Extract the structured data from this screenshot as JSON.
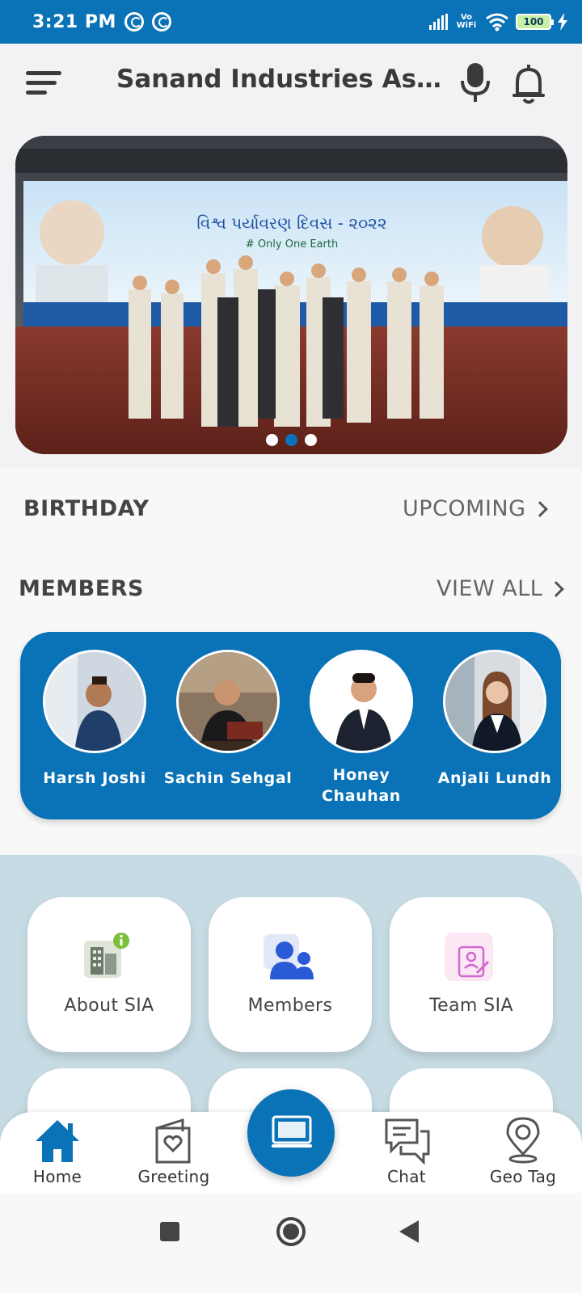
{
  "status_bar": {
    "time": "3:21 PM",
    "network_label": "Vo WiFi",
    "battery": "100"
  },
  "app_bar": {
    "title": "Sanand Industries Associ..."
  },
  "banner": {
    "headline": "વિશ્વ પર્યાવરણ દિવસ - ૨૦૨૨",
    "tagline": "# Only One Earth",
    "active_slide": 2,
    "slide_count": 3
  },
  "birthday": {
    "title": "BIRTHDAY",
    "link": "UPCOMING"
  },
  "members_section": {
    "title": "MEMBERS",
    "link": "VIEW ALL",
    "items": [
      {
        "name": "Harsh  Joshi"
      },
      {
        "name": "Sachin  Sehgal"
      },
      {
        "name": "Honey\nChauhan"
      },
      {
        "name": "Anjali  Lundh"
      }
    ]
  },
  "tiles": [
    {
      "label": "About SIA",
      "icon": "building-info-icon"
    },
    {
      "label": "Members",
      "icon": "users-icon"
    },
    {
      "label": "Team SIA",
      "icon": "id-card-icon"
    }
  ],
  "bottom_nav": {
    "items": [
      {
        "label": "Home",
        "icon": "home-icon"
      },
      {
        "label": "Greeting",
        "icon": "greeting-card-icon"
      },
      {
        "label": "Chat",
        "icon": "chat-icon"
      },
      {
        "label": "Geo Tag",
        "icon": "location-pin-icon"
      }
    ],
    "center_action_icon": "screen-icon"
  },
  "colors": {
    "primary": "#0a72b6",
    "grid_background": "#c7dbe4"
  }
}
